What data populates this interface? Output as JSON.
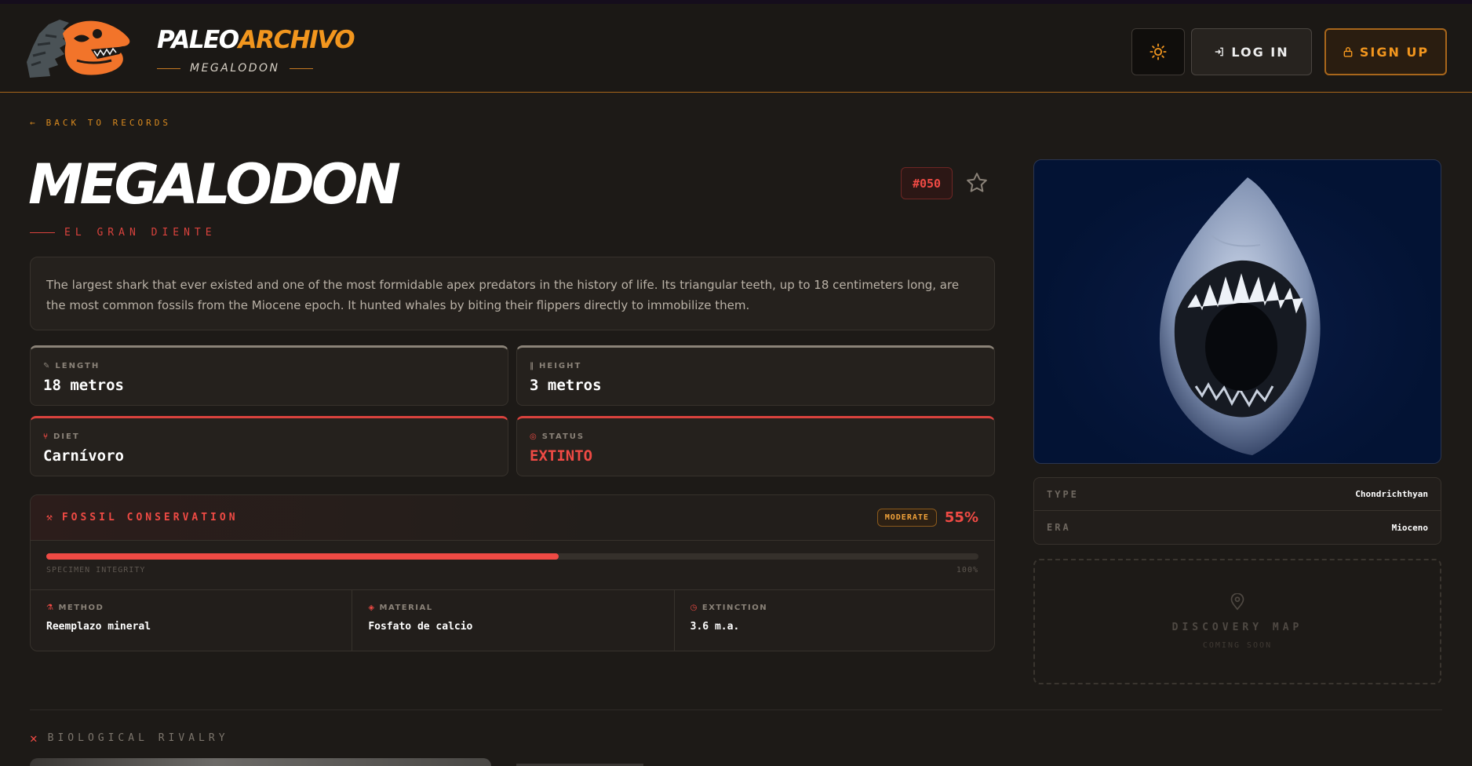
{
  "app": {
    "brand_white": "PALEO",
    "brand_orange": "ARCHIVO",
    "subtitle": "MEGALODON"
  },
  "header": {
    "theme_icon": "sun-icon",
    "login_label": "LOG IN",
    "signup_label": "SIGN UP"
  },
  "nav": {
    "back_label": "BACK TO RECORDS"
  },
  "record": {
    "name": "MEGALODON",
    "nickname": "EL GRAN DIENTE",
    "number": "#050",
    "description": "The largest shark that ever existed and one of the most formidable apex predators in the history of life. Its triangular teeth, up to 18 centimeters long, are the most common fossils from the Miocene epoch. It hunted whales by biting their flippers directly to immobilize them."
  },
  "stats": [
    {
      "label": "LENGTH",
      "value": "18 metros",
      "icon": "ruler-icon"
    },
    {
      "label": "HEIGHT",
      "value": "3 metros",
      "icon": "height-icon"
    },
    {
      "label": "DIET",
      "value": "Carnívoro",
      "icon": "utensils-icon"
    },
    {
      "label": "STATUS",
      "value": "EXTINTO",
      "icon": "skull-icon"
    }
  ],
  "fossil": {
    "title": "FOSSIL CONSERVATION",
    "badge": "MODERATE",
    "percent_label": "55%",
    "integrity": 0.55,
    "bar_left_label": "SPECIMEN INTEGRITY",
    "bar_right_label": "100%",
    "details": [
      {
        "label": "METHOD",
        "value": "Reemplazo mineral",
        "icon": "flask-icon"
      },
      {
        "label": "MATERIAL",
        "value": "Fosfato de calcio",
        "icon": "layers-icon"
      },
      {
        "label": "EXTINCTION",
        "value": "3.6 m.a.",
        "icon": "clock-icon"
      }
    ]
  },
  "meta": [
    {
      "key": "TYPE",
      "value": "Chondrichthyan"
    },
    {
      "key": "ERA",
      "value": "Mioceno"
    }
  ],
  "map": {
    "title": "DISCOVERY MAP",
    "subtitle": "COMING SOON"
  },
  "rivalry": {
    "title": "BIOLOGICAL RIVALRY"
  },
  "colors": {
    "accent_orange": "#f2961e",
    "accent_red": "#ef4a44",
    "background": "#1d1a17"
  }
}
